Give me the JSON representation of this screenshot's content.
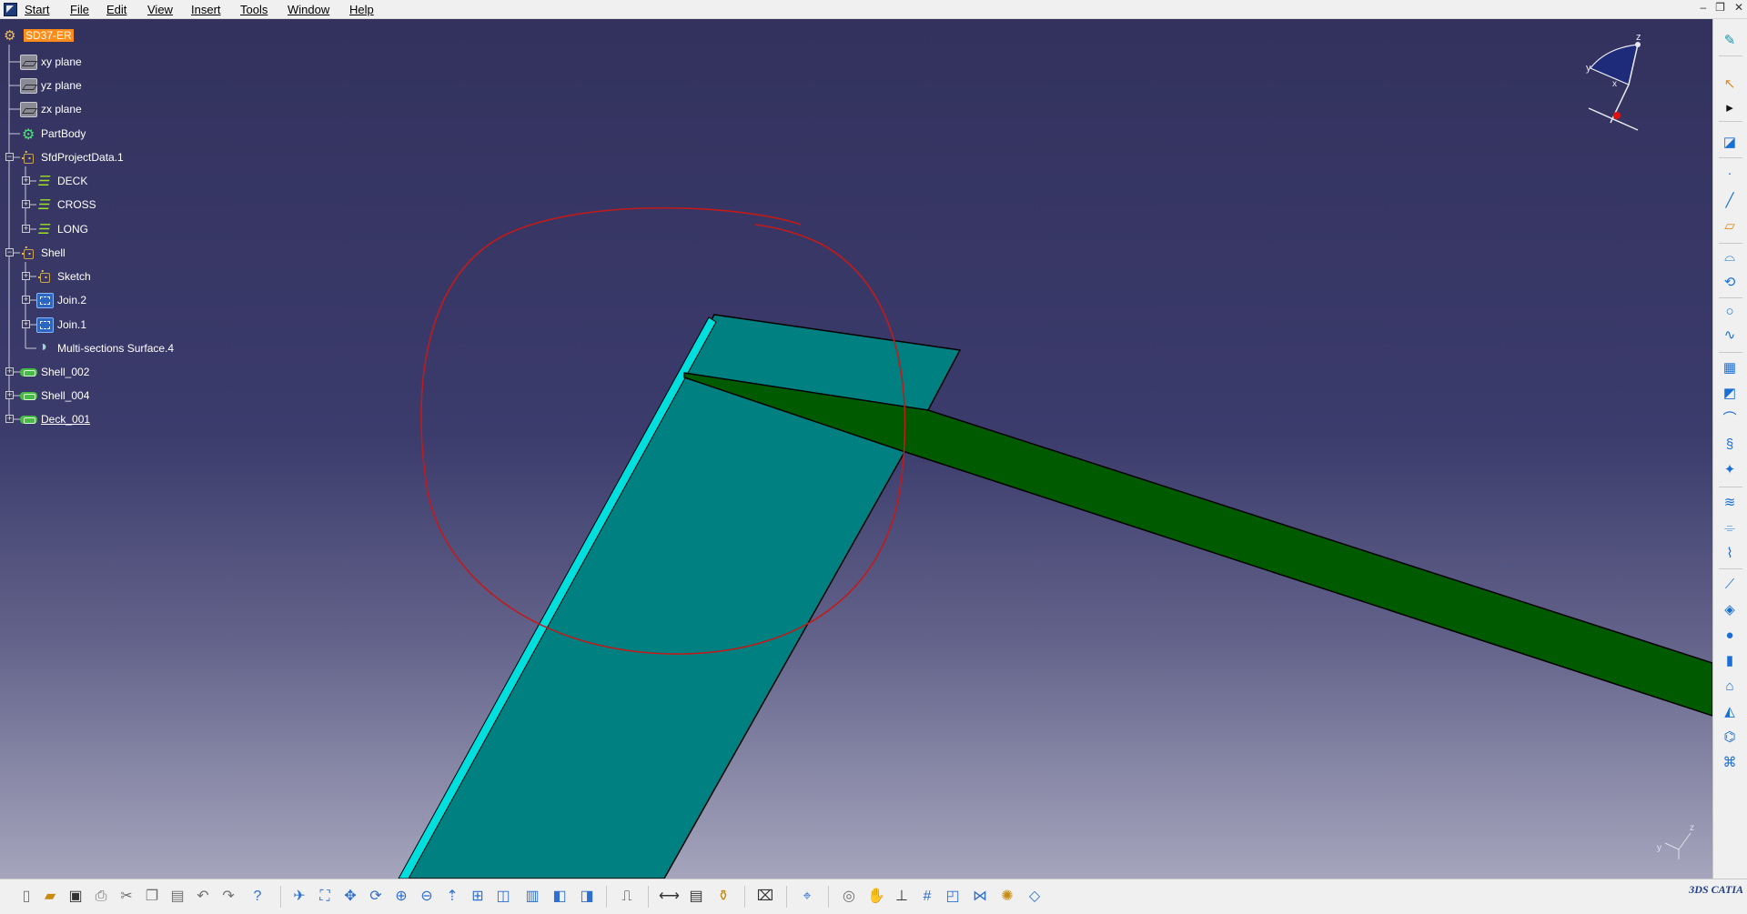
{
  "menubar": {
    "items": [
      {
        "label": "Start"
      },
      {
        "label": "File"
      },
      {
        "label": "Edit"
      },
      {
        "label": "View"
      },
      {
        "label": "Insert"
      },
      {
        "label": "Tools"
      },
      {
        "label": "Window"
      },
      {
        "label": "Help"
      }
    ],
    "window_controls": [
      "–",
      "❐",
      "✕"
    ]
  },
  "tree": {
    "root": {
      "label": "SD37-ER",
      "icon": "part-icon"
    },
    "nodes": [
      {
        "label": "xy plane",
        "icon": "plane-icon"
      },
      {
        "label": "yz plane",
        "icon": "plane-icon"
      },
      {
        "label": "zx plane",
        "icon": "plane-icon"
      },
      {
        "label": "PartBody",
        "icon": "body-icon"
      },
      {
        "label": "SfdProjectData.1",
        "icon": "geometrical-set-icon"
      },
      {
        "label": "DECK",
        "icon": "feature-icon"
      },
      {
        "label": "CROSS",
        "icon": "feature-icon"
      },
      {
        "label": "LONG",
        "icon": "feature-icon"
      },
      {
        "label": "Shell",
        "icon": "geometrical-set-icon"
      },
      {
        "label": "Sketch",
        "icon": "geometrical-set-icon"
      },
      {
        "label": "Join.2",
        "icon": "join-icon"
      },
      {
        "label": "Join.1",
        "icon": "join-icon"
      },
      {
        "label": "Multi-sections Surface.4",
        "icon": "multi-section-surface-icon"
      },
      {
        "label": "Shell_002",
        "icon": "shell-icon"
      },
      {
        "label": "Shell_004",
        "icon": "shell-icon"
      },
      {
        "label": "Deck_001",
        "icon": "shell-icon"
      }
    ]
  },
  "compass": {
    "x": "x",
    "y": "y",
    "z": "z"
  },
  "mini_axis": {
    "y": "y",
    "z": "z"
  },
  "colors": {
    "plate": "#008080",
    "plate_edge": "#00dede",
    "stiffener": "#005a00",
    "annotation": "#c21a1a",
    "selection": "#ff8c1a"
  },
  "right_toolbar": {
    "icons": [
      "sketcher-icon",
      "select-icon",
      "expand-icon",
      "sketch-icon",
      "point-icon",
      "line-icon",
      "plane-icon",
      "extrude-icon",
      "revolve-icon",
      "circle-icon",
      "spline-icon",
      "join-icon",
      "healing-icon",
      "curve-icon",
      "helix-icon",
      "intersect-icon",
      "sweep-icon",
      "fill-icon",
      "blend-icon",
      "offset-icon",
      "multi-section-icon",
      "sphere-icon",
      "cylinder-icon",
      "surface-icon",
      "loft-icon",
      "wire-icon",
      "edge-icon"
    ]
  },
  "bottom_toolbar": {
    "icons": [
      "new-icon",
      "open-icon",
      "save-icon",
      "print-icon",
      "cut-icon",
      "copy-icon",
      "paste-icon",
      "undo-icon",
      "redo-icon",
      "whats-this-icon",
      "fly-icon",
      "fit-all-icon",
      "pan-icon",
      "rotate-icon",
      "zoom-in-icon",
      "zoom-out-icon",
      "normal-view-icon",
      "multi-view-icon",
      "iso-view-icon",
      "shading-icon",
      "hide-show-icon",
      "swap-space-icon",
      "measure-icon",
      "measure-between-icon",
      "mass-icon",
      "inertia-icon",
      "capture-icon",
      "compass-icon",
      "rendering-icon",
      "hand-icon",
      "axis-icon",
      "grid-icon",
      "cylinder-view-icon",
      "edge-analysis-icon",
      "lighting-icon",
      "layer-icon"
    ]
  },
  "logo": {
    "text": "3DS CATIA"
  }
}
